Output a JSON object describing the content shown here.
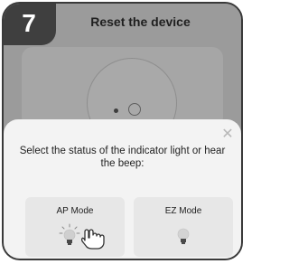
{
  "step": {
    "number": "7",
    "title": "Reset the device"
  },
  "sheet": {
    "close_icon": "close-icon",
    "prompt": "Select the status of the indicator light or hear the beep:",
    "modes": [
      {
        "label": "AP Mode",
        "icon": "bulb-blinking-icon",
        "pointer": "hand-pointer-icon"
      },
      {
        "label": "EZ Mode",
        "icon": "bulb-icon"
      }
    ]
  },
  "colors": {
    "overlay": "#9b9b9b",
    "badge": "#3f3f3f",
    "sheet": "#f3f3f3",
    "card": "#e7e7e7"
  }
}
